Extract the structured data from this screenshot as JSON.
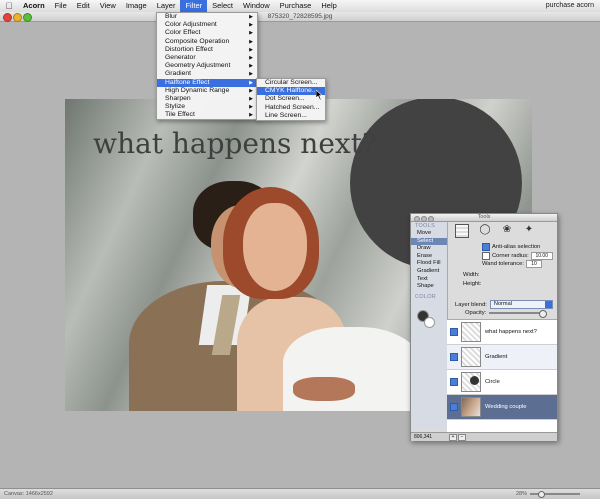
{
  "menubar": {
    "app": "Acorn",
    "items": [
      "File",
      "Edit",
      "View",
      "Image",
      "Layer",
      "Filter",
      "Select",
      "Window",
      "Purchase",
      "Help"
    ],
    "active": "Filter",
    "right_text": "purchase acorn"
  },
  "document": {
    "title": "875320_72828595.jpg",
    "headline": "what happens next?"
  },
  "filter_menu": {
    "items": [
      {
        "label": "Blur",
        "submenu": true
      },
      {
        "label": "Color Adjustment",
        "submenu": true
      },
      {
        "label": "Color Effect",
        "submenu": true
      },
      {
        "label": "Composite Operation",
        "submenu": true
      },
      {
        "label": "Distortion Effect",
        "submenu": true
      },
      {
        "label": "Generator",
        "submenu": true
      },
      {
        "label": "Geometry Adjustment",
        "submenu": true
      },
      {
        "label": "Gradient",
        "submenu": true
      },
      {
        "label": "Halftone Effect",
        "submenu": true,
        "selected": true
      },
      {
        "label": "High Dynamic Range",
        "submenu": true
      },
      {
        "label": "Sharpen",
        "submenu": true
      },
      {
        "label": "Stylize",
        "submenu": true
      },
      {
        "label": "Tile Effect",
        "submenu": true
      }
    ]
  },
  "halftone_submenu": {
    "items": [
      {
        "label": "Circular Screen..."
      },
      {
        "label": "CMYK Halftone...",
        "selected": true
      },
      {
        "label": "Dot Screen..."
      },
      {
        "label": "Hatched Screen..."
      },
      {
        "label": "Line Screen..."
      }
    ]
  },
  "tools_panel": {
    "title": "Tools",
    "tools_header": "TOOLS",
    "tools": [
      "Move",
      "Select",
      "Draw",
      "Erase",
      "Flood Fill",
      "Gradient",
      "Text",
      "Shape"
    ],
    "selected_tool": "Select",
    "color_header": "COLOR",
    "antialias_label": "Anti-alias selection",
    "antialias_checked": true,
    "corner_radius_label": "Corner radius:",
    "corner_radius_value": "10.00",
    "corner_radius_checked": false,
    "wand_tolerance_label": "Wand tolerance:",
    "wand_tolerance_value": "10",
    "width_label": "Width:",
    "height_label": "Height:",
    "layer_blend_label": "Layer blend:",
    "layer_blend_value": "Normal",
    "opacity_label": "Opacity:",
    "opacity_value": 1.0,
    "coords": "806,341",
    "layers": [
      {
        "name": "what happens next?",
        "visible": true
      },
      {
        "name": "Gradient",
        "visible": true
      },
      {
        "name": "Circle",
        "visible": true
      },
      {
        "name": "Wedding couple",
        "visible": true,
        "selected": true
      }
    ]
  },
  "statusbar": {
    "canvas_label": "Canvas: 1466x2592",
    "zoom": "28%"
  },
  "colors": {
    "menu_highlight": "#3a6fe0",
    "layer_selected": "#5c6f92",
    "circle": "#424242"
  }
}
